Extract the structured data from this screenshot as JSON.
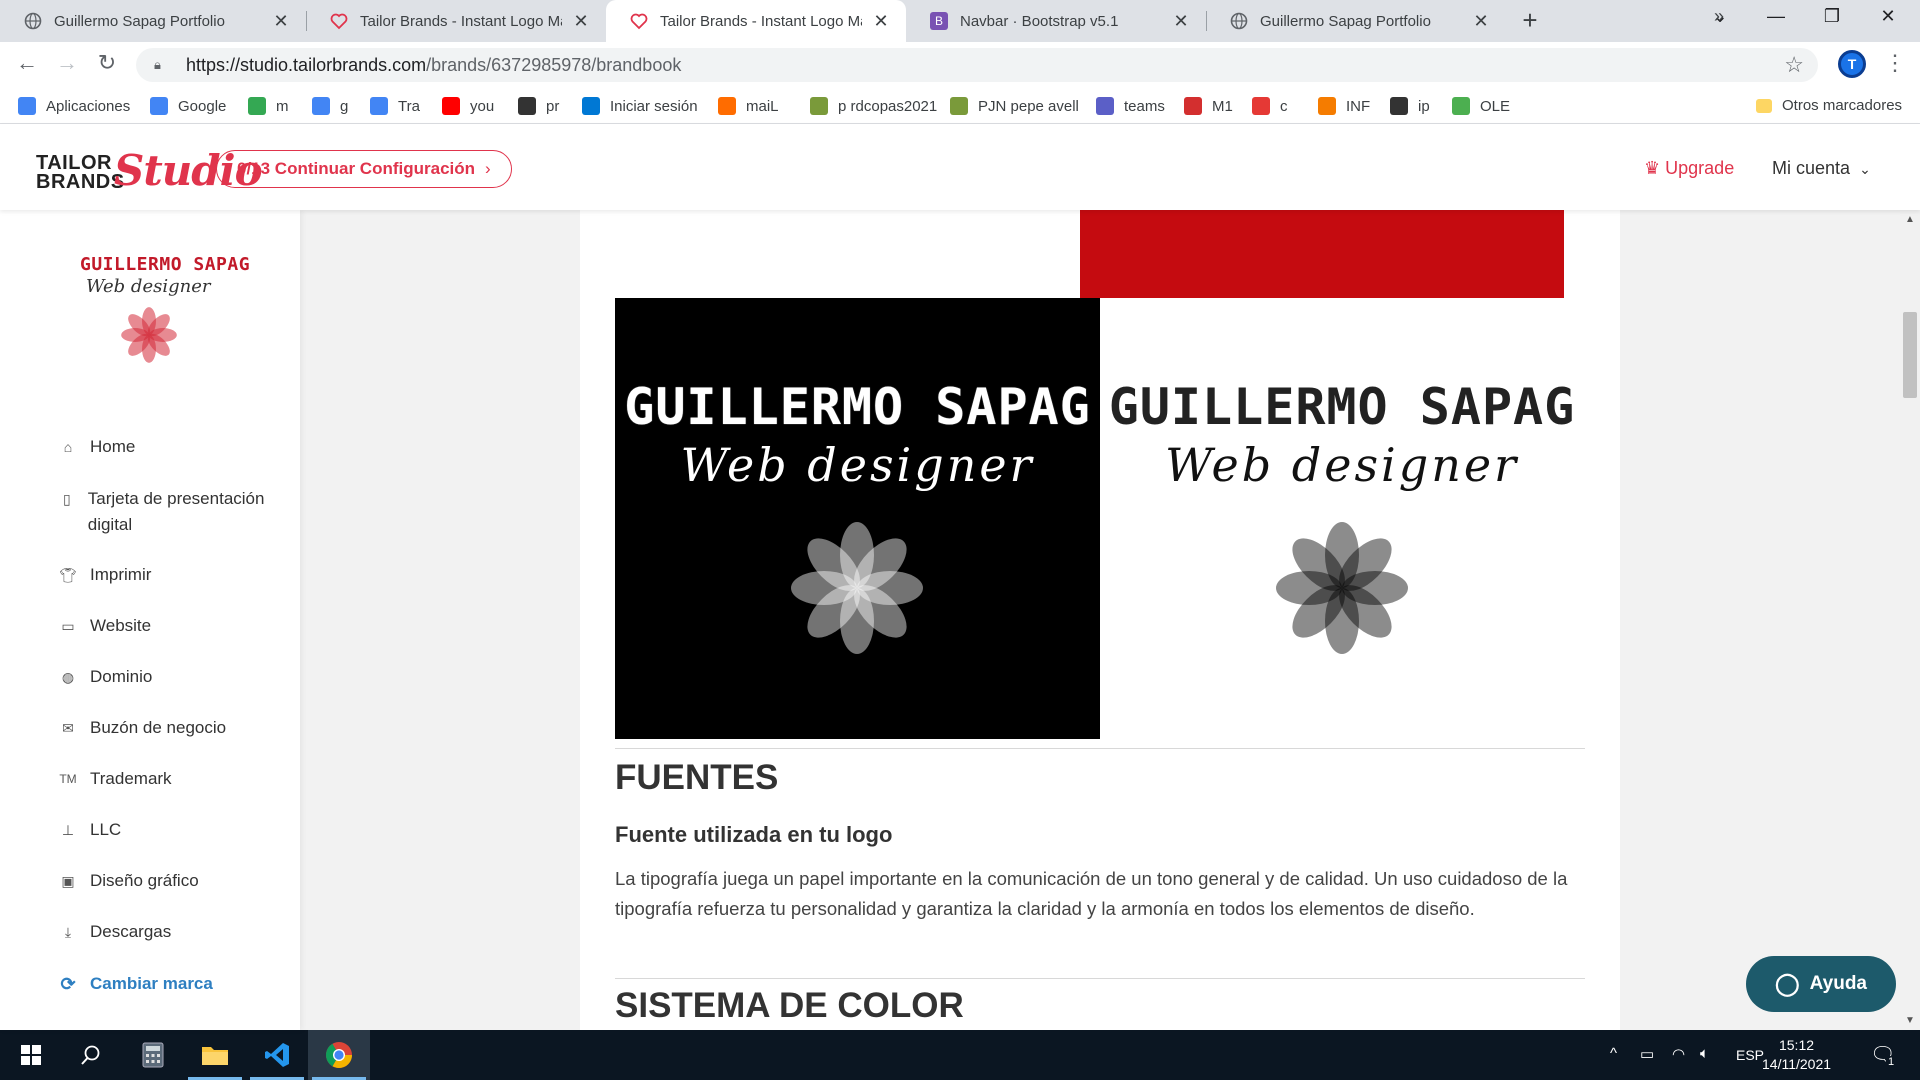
{
  "browser": {
    "tabs": [
      {
        "title": "Guillermo Sapag Portfolio",
        "icon": "globe-icon",
        "active": false
      },
      {
        "title": "Tailor Brands - Instant Logo Make",
        "icon": "tailor-heart-icon",
        "active": false
      },
      {
        "title": "Tailor Brands - Instant Logo Make",
        "icon": "tailor-heart-icon",
        "active": true
      },
      {
        "title": "Navbar · Bootstrap v5.1",
        "icon": "bootstrap-icon",
        "active": false
      },
      {
        "title": "Guillermo Sapag Portfolio",
        "icon": "globe-icon",
        "active": false
      }
    ],
    "url_host": "https://studio.tailorbrands.com",
    "url_path": "/brands/6372985978/brandbook",
    "profile_initial": "T",
    "bookmarks": [
      {
        "label": "Aplicaciones",
        "icon": "apps-grid-icon",
        "color": "#4285f4"
      },
      {
        "label": "Google",
        "icon": "google-icon",
        "color": "#4285f4"
      },
      {
        "label": "m",
        "icon": "maps-pin-icon",
        "color": "#34a853"
      },
      {
        "label": "g",
        "icon": "google-icon",
        "color": "#4285f4"
      },
      {
        "label": "Tra",
        "icon": "translate-icon",
        "color": "#4285f4"
      },
      {
        "label": "you",
        "icon": "youtube-icon",
        "color": "#ff0000"
      },
      {
        "label": "pr",
        "icon": "soccer-ball-icon",
        "color": "#333333"
      },
      {
        "label": "Iniciar sesión",
        "icon": "outlook-icon",
        "color": "#0078d4"
      },
      {
        "label": "maiL",
        "icon": "cp-mail-icon",
        "color": "#ff6c00"
      },
      {
        "label": "p rdcopas2021",
        "icon": "badge-icon",
        "color": "#7a9a3a"
      },
      {
        "label": "PJN pepe avell",
        "icon": "badge-icon",
        "color": "#7a9a3a"
      },
      {
        "label": "teams",
        "icon": "teams-icon",
        "color": "#5b5fc7"
      },
      {
        "label": "M1",
        "icon": "m1-icon",
        "color": "#d32f2f"
      },
      {
        "label": "c",
        "icon": "c-icon",
        "color": "#e53935"
      },
      {
        "label": "INF",
        "icon": "inf-icon",
        "color": "#f57c00"
      },
      {
        "label": "ip",
        "icon": "ip-icon",
        "color": "#333333"
      },
      {
        "label": "OLE",
        "icon": "ole-icon",
        "color": "#4caf50"
      }
    ],
    "bookmarks_other": "Otros marcadores"
  },
  "header": {
    "logo_line1": "TAILOR",
    "logo_line2": "BRANDS",
    "logo_script": "Studio",
    "continue_label": "0/13 Continuar Configuración",
    "upgrade_label": "Upgrade",
    "account_label": "Mi cuenta",
    "accent_color": "#e0344c"
  },
  "sidebar": {
    "brand_name": "GUILLERMO SAPAG",
    "brand_tagline": "Web designer",
    "items": [
      {
        "label": "Home",
        "icon": "home-icon"
      },
      {
        "label": "Tarjeta de presentación digital",
        "icon": "id-card-icon"
      },
      {
        "label": "Imprimir",
        "icon": "tshirt-icon"
      },
      {
        "label": "Website",
        "icon": "monitor-icon"
      },
      {
        "label": "Dominio",
        "icon": "globe-icon"
      },
      {
        "label": "Buzón de negocio",
        "icon": "mail-icon"
      },
      {
        "label": "Trademark",
        "icon": "tm-icon"
      },
      {
        "label": "LLC",
        "icon": "stamp-icon"
      },
      {
        "label": "Diseño gráfico",
        "icon": "image-icon"
      },
      {
        "label": "Descargas",
        "icon": "download-icon"
      }
    ],
    "switch_brand_label": "Cambiar marca"
  },
  "main": {
    "logo_name": "GUILLERMO SAPAG",
    "logo_tagline": "Web designer",
    "fonts_heading": "FUENTES",
    "fonts_subheading": "Fuente utilizada en tu logo",
    "fonts_body": "La tipografía juega un papel importante en la comunicación de un tono general y de calidad. Un uso cuidadoso de la tipografía refuerza tu personalidad y garantiza la claridad y la armonía en todos los elementos de diseño.",
    "color_heading": "SISTEMA DE COLOR",
    "help_label": "Ayuda",
    "brand_red": "#c50b10"
  },
  "taskbar": {
    "language": "ESP",
    "time": "15:12",
    "date": "14/11/2021",
    "notification_count": "1"
  }
}
